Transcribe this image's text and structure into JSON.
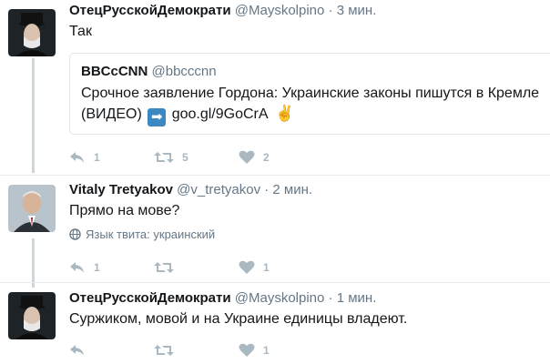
{
  "tweets": [
    {
      "fullname": "ОтецРусскойДемократи",
      "username": "@Mayskolpino",
      "dot": "·",
      "time": "3 мин.",
      "text": "Так",
      "actions": {
        "reply": "1",
        "retweet": "5",
        "like": "2"
      }
    },
    {
      "fullname": "Vitaly Tretyakov",
      "username": "@v_tretyakov",
      "dot": "·",
      "time": "2 мин.",
      "text": "Прямо на мове?",
      "language_label": "Язык твита: украинский",
      "actions": {
        "reply": "1",
        "retweet": "",
        "like": "1"
      }
    },
    {
      "fullname": "ОтецРусскойДемократи",
      "username": "@Mayskolpino",
      "dot": "·",
      "time": "1 мин.",
      "text": "Суржиком, мовой и на Украине единицы владеют.",
      "actions": {
        "reply": "",
        "retweet": "",
        "like": "1"
      }
    }
  ],
  "quote": {
    "fullname": "BBCcCNN",
    "username": "@bbcccnn",
    "text_line1": "Срочное заявление Гордона: Украинские законы пишутся в Кремле",
    "text_prefix": "(ВИДЕО)",
    "arrow_glyph": "➡",
    "link": "goo.gl/9GoCrA",
    "victory_glyph": "✌"
  },
  "colors": {
    "muted": "#657786",
    "icon": "#aab8c2",
    "border": "#e1e8ed",
    "thread": "#ccd6dd"
  }
}
